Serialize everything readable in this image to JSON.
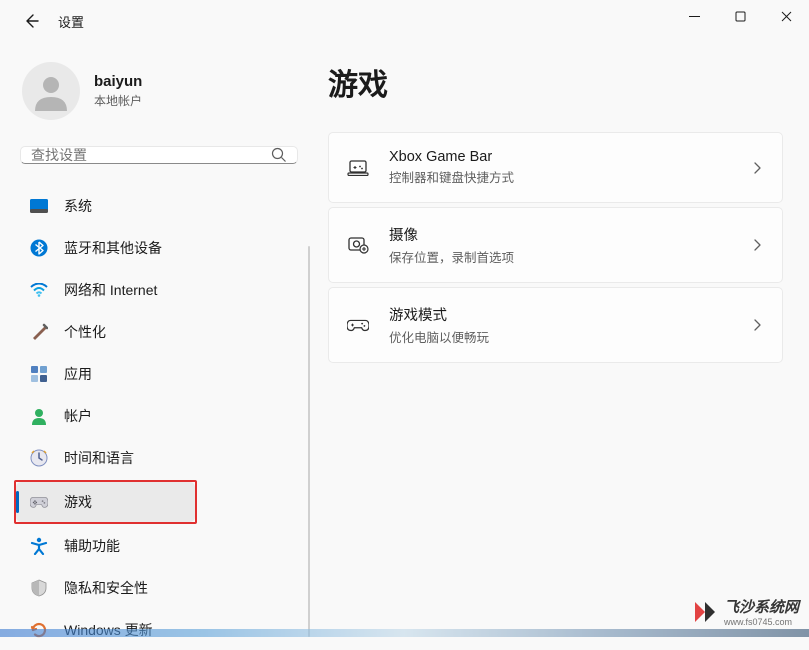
{
  "window": {
    "back_aria": "返回"
  },
  "app_title": "设置",
  "user": {
    "name": "baiyun",
    "type": "本地帐户"
  },
  "search": {
    "placeholder": "查找设置"
  },
  "sidebar": {
    "items": [
      {
        "label": "系统"
      },
      {
        "label": "蓝牙和其他设备"
      },
      {
        "label": "网络和 Internet"
      },
      {
        "label": "个性化"
      },
      {
        "label": "应用"
      },
      {
        "label": "帐户"
      },
      {
        "label": "时间和语言"
      },
      {
        "label": "游戏"
      },
      {
        "label": "辅助功能"
      },
      {
        "label": "隐私和安全性"
      },
      {
        "label": "Windows 更新"
      }
    ]
  },
  "page": {
    "title": "游戏"
  },
  "cards": [
    {
      "title": "Xbox Game Bar",
      "sub": "控制器和键盘快捷方式"
    },
    {
      "title": "摄像",
      "sub": "保存位置，录制首选项"
    },
    {
      "title": "游戏模式",
      "sub": "优化电脑以便畅玩"
    }
  ],
  "watermark": {
    "cn": "飞沙系统网",
    "url": "www.fs0745.com"
  }
}
